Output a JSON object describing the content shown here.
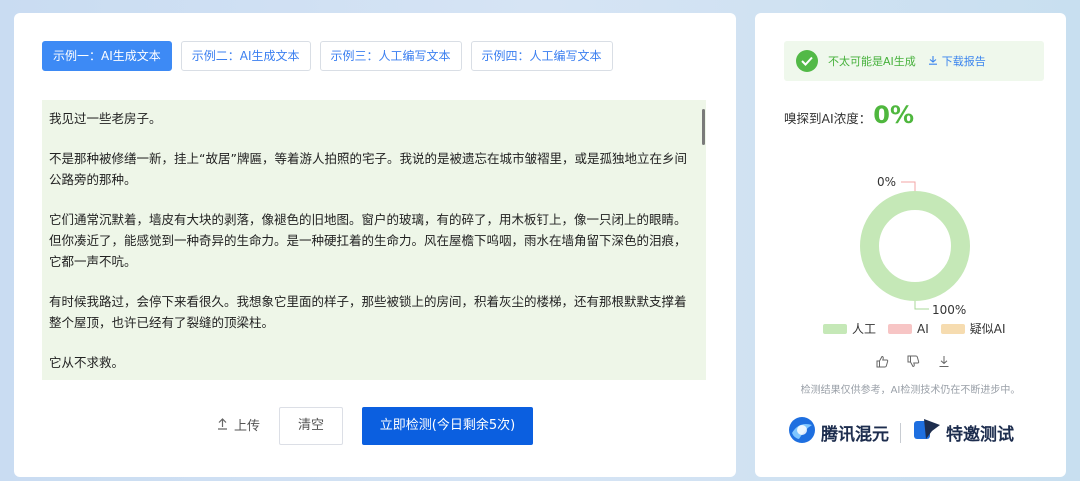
{
  "tabs": [
    {
      "label": "示例一：AI生成文本",
      "active": true
    },
    {
      "label": "示例二：AI生成文本",
      "active": false
    },
    {
      "label": "示例三：人工编写文本",
      "active": false
    },
    {
      "label": "示例四：人工编写文本",
      "active": false
    }
  ],
  "text_content": {
    "paragraphs": [
      "我见过一些老房子。",
      "不是那种被修缮一新，挂上“故居”牌匾，等着游人拍照的宅子。我说的是被遗忘在城市皱褶里，或是孤独地立在乡间公路旁的那种。",
      "它们通常沉默着，墙皮有大块的剥落，像褪色的旧地图。窗户的玻璃，有的碎了，用木板钉上，像一只闭上的眼睛。但你凑近了，能感觉到一种奇异的生命力。是一种硬扛着的生命力。风在屋檐下呜咽，雨水在墙角留下深色的泪痕，它都一声不吭。",
      "有时候我路过，会停下来看很久。我想象它里面的样子，那些被锁上的房间，积着灰尘的楼梯，还有那根默默支撑着整个屋顶，也许已经有了裂缝的顶梁柱。",
      "它从不求救。"
    ]
  },
  "actions": {
    "upload_label": "上传",
    "clear_label": "清空",
    "detect_label": "立即检测(今日剩余5次)"
  },
  "result": {
    "verdict": "不太可能是AI生成",
    "download_label": "下载报告",
    "ratio_label": "嗅探到AI浓度：",
    "ratio_value": "0%"
  },
  "chart_data": {
    "type": "pie",
    "categories": [
      "人工",
      "AI",
      "疑似AI"
    ],
    "values": [
      100,
      0,
      0
    ],
    "data_labels": [
      "100%",
      "0%"
    ],
    "colors": [
      "#c5e8b7",
      "#f7c5c5",
      "#f6dcb0"
    ],
    "legend_position": "bottom"
  },
  "disclaimer": "检测结果仅供参考，AI检测技术仍在不断进步中。",
  "brands": {
    "brand1": "腾讯混元",
    "brand2": "特邀测试"
  },
  "icons": [
    "check-icon",
    "download-icon",
    "upload-icon",
    "thumbs-up-icon",
    "thumbs-down-icon"
  ]
}
